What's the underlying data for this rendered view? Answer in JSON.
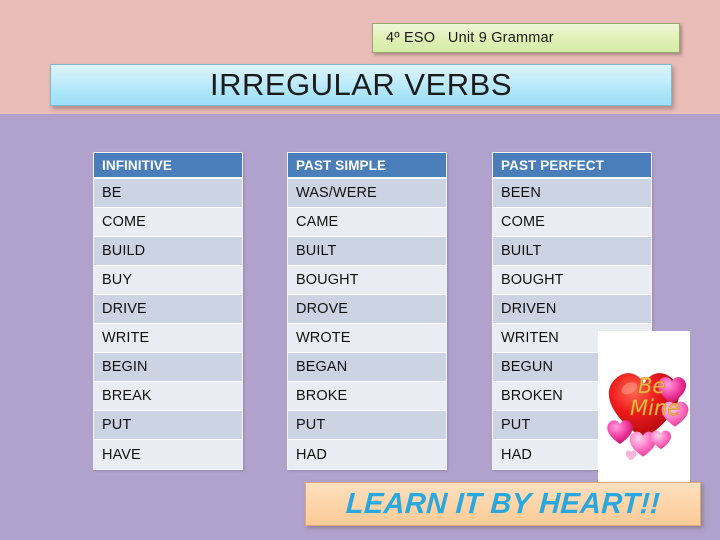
{
  "slide": {
    "background_color": "#b0a2cc",
    "top_band_color": "#e9bcb8"
  },
  "unit_banner": {
    "text": "4º ESO   Unit 9 Grammar",
    "background_color": "#dff0b4"
  },
  "title_banner": {
    "text": "IRREGULAR VERBS",
    "background_color": "#a8e4f8"
  },
  "bottom_banner": {
    "text": "LEARN IT BY HEART!!",
    "background_color": "#fcd6ac",
    "text_color": "#29a8e0"
  },
  "heart_image": {
    "name": "be-mine-heart-image",
    "line1": "Be",
    "line2": "Mine",
    "heart_color": "#e8151b",
    "text_color": "#f2c14a"
  },
  "columns": [
    {
      "header": "INFINITIVE",
      "cells": [
        "BE",
        "COME",
        "BUILD",
        "BUY",
        "DRIVE",
        "WRITE",
        "BEGIN",
        "BREAK",
        "PUT",
        "HAVE"
      ]
    },
    {
      "header": "PAST SIMPLE",
      "cells": [
        "WAS/WERE",
        "CAME",
        "BUILT",
        "BOUGHT",
        "DROVE",
        "WROTE",
        "BEGAN",
        "BROKE",
        "PUT",
        "HAD"
      ]
    },
    {
      "header": "PAST PERFECT",
      "cells": [
        "BEEN",
        "COME",
        "BUILT",
        "BOUGHT",
        "DRIVEN",
        "WRITEN",
        "BEGUN",
        "BROKEN",
        "PUT",
        "HAD"
      ]
    }
  ]
}
